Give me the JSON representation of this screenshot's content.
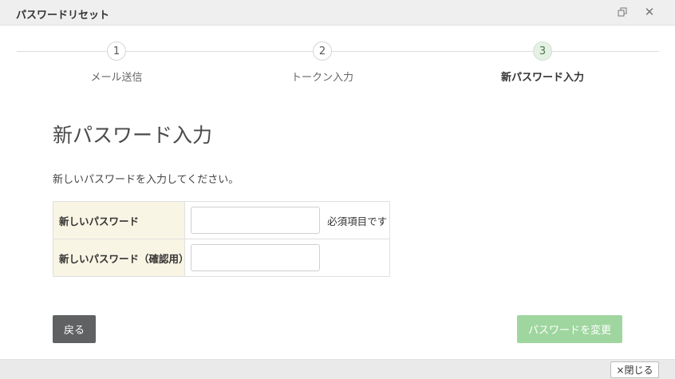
{
  "window": {
    "title": "パスワードリセット",
    "restore_icon": "restore-window-icon",
    "close_icon": "close-icon"
  },
  "steps": [
    {
      "number": "1",
      "label": "メール送信",
      "active": false
    },
    {
      "number": "2",
      "label": "トークン入力",
      "active": false
    },
    {
      "number": "3",
      "label": "新パスワード入力",
      "active": true
    }
  ],
  "main": {
    "title": "新パスワード入力",
    "instruction": "新しいパスワードを入力してください。",
    "fields": [
      {
        "label": "新しいパスワード",
        "value": "",
        "note": "必須項目です"
      },
      {
        "label": "新しいパスワード（確認用）",
        "value": "",
        "note": ""
      }
    ]
  },
  "buttons": {
    "back": "戻る",
    "submit": "パスワードを変更",
    "close": "×閉じる"
  },
  "colors": {
    "submit_button": "#9fd69f",
    "back_button": "#5f6163",
    "label_cell": "#f8f5e4",
    "active_step": "#e4f1e4"
  }
}
